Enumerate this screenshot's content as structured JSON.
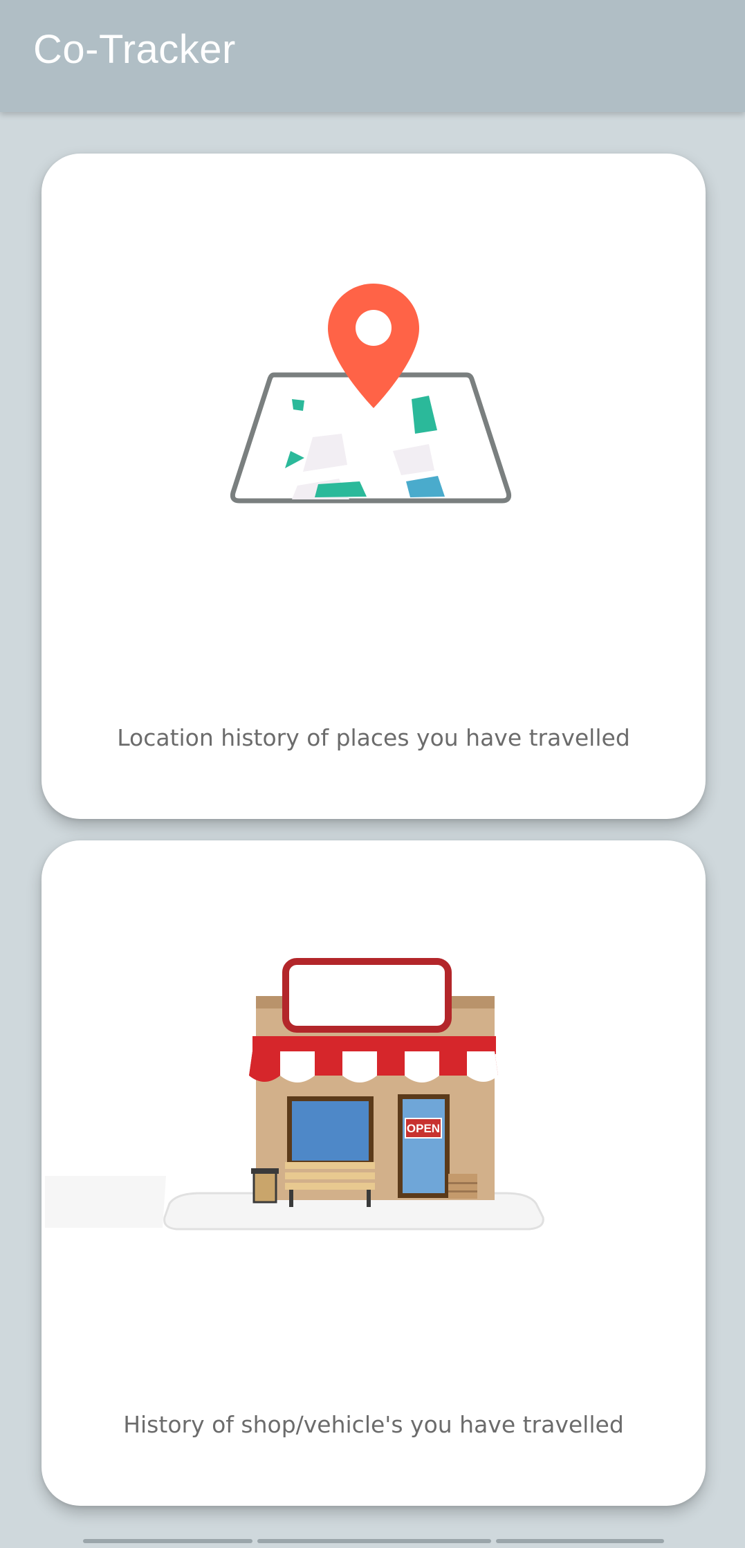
{
  "app": {
    "title": "Co-Tracker"
  },
  "cards": [
    {
      "caption": "Location history of places you have travelled",
      "illustration": "map-pin-icon"
    },
    {
      "caption": "History of shop/vehicle's you have travelled",
      "illustration": "shop-storefront-icon",
      "sign_text": "OPEN"
    }
  ],
  "colors": {
    "appbar": "#b0bec5",
    "background": "#cfd8dc",
    "card": "#ffffff",
    "caption": "#6b6b6b",
    "pin": "#ff6347"
  }
}
